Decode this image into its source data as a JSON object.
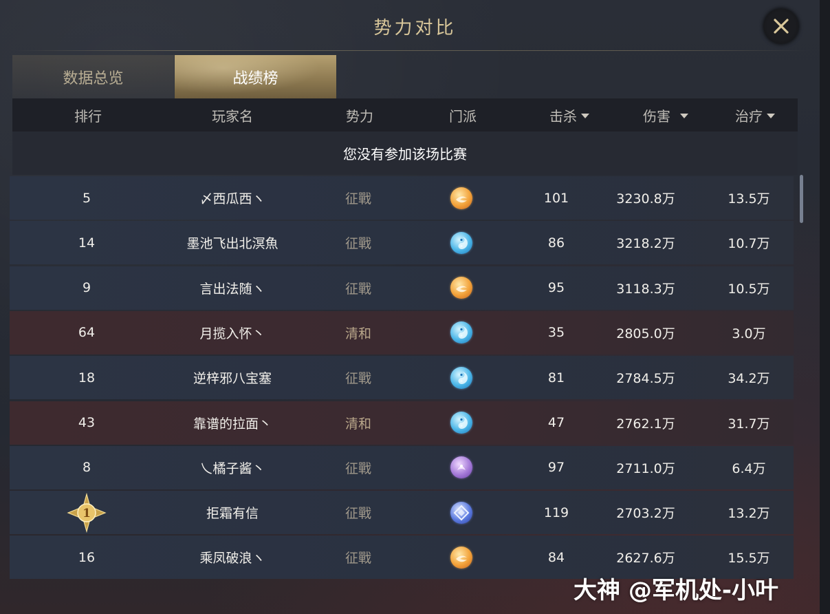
{
  "window": {
    "title": "势力对比"
  },
  "tabs": [
    {
      "label": "数据总览",
      "active": false
    },
    {
      "label": "战绩榜",
      "active": true
    }
  ],
  "table": {
    "columns": [
      {
        "label": "排行",
        "sortable": false
      },
      {
        "label": "玩家名",
        "sortable": false
      },
      {
        "label": "势力",
        "sortable": false
      },
      {
        "label": "门派",
        "sortable": false
      },
      {
        "label": "击杀",
        "sortable": true
      },
      {
        "label": "伤害",
        "sortable": true
      },
      {
        "label": "治疗",
        "sortable": true
      }
    ],
    "notice": "您没有参加该场比赛",
    "rows": [
      {
        "rank": "5",
        "name": "〆西瓜西ヽ",
        "faction": "征戰",
        "sect_icon": "orange-sect-icon",
        "kills": "101",
        "damage": "3230.8万",
        "healing": "13.5万",
        "tint": "blue"
      },
      {
        "rank": "14",
        "name": "墨池飞出北溟魚",
        "faction": "征戰",
        "sect_icon": "blue-sect-icon",
        "kills": "86",
        "damage": "3218.2万",
        "healing": "10.7万",
        "tint": "blue"
      },
      {
        "rank": "9",
        "name": "言出法随ヽ",
        "faction": "征戰",
        "sect_icon": "orange-sect-icon",
        "kills": "95",
        "damage": "3118.3万",
        "healing": "10.5万",
        "tint": "blue"
      },
      {
        "rank": "64",
        "name": "月揽入怀丶",
        "faction": "清和",
        "sect_icon": "blue-sect-icon",
        "kills": "35",
        "damage": "2805.0万",
        "healing": "3.0万",
        "tint": "red"
      },
      {
        "rank": "18",
        "name": "逆梓邪八宝塞",
        "faction": "征戰",
        "sect_icon": "blue-sect-icon",
        "kills": "81",
        "damage": "2784.5万",
        "healing": "34.2万",
        "tint": "blue"
      },
      {
        "rank": "43",
        "name": "靠谱的拉面丶",
        "faction": "清和",
        "sect_icon": "blue-sect-icon",
        "kills": "47",
        "damage": "2762.1万",
        "healing": "31.7万",
        "tint": "red"
      },
      {
        "rank": "8",
        "name": "乀橘子酱丶",
        "faction": "征戰",
        "sect_icon": "purple-sect-icon",
        "kills": "97",
        "damage": "2711.0万",
        "healing": "6.4万",
        "tint": "blue"
      },
      {
        "rank": "1",
        "name": "拒霜有信",
        "faction": "征戰",
        "sect_icon": "navy-sect-icon",
        "kills": "119",
        "damage": "2703.2万",
        "healing": "13.2万",
        "tint": "blue",
        "medal": true
      },
      {
        "rank": "16",
        "name": "乘凤破浪ヽ",
        "faction": "征戰",
        "sect_icon": "orange-sect-icon",
        "kills": "84",
        "damage": "2627.6万",
        "healing": "15.5万",
        "tint": "blue"
      }
    ]
  },
  "watermark": "大神 @军机处-小叶",
  "colors": {
    "title": "#d9c79a",
    "row_blue": "#2c3444",
    "row_red": "#3e2a2f",
    "tab_active": "#b49f70"
  }
}
